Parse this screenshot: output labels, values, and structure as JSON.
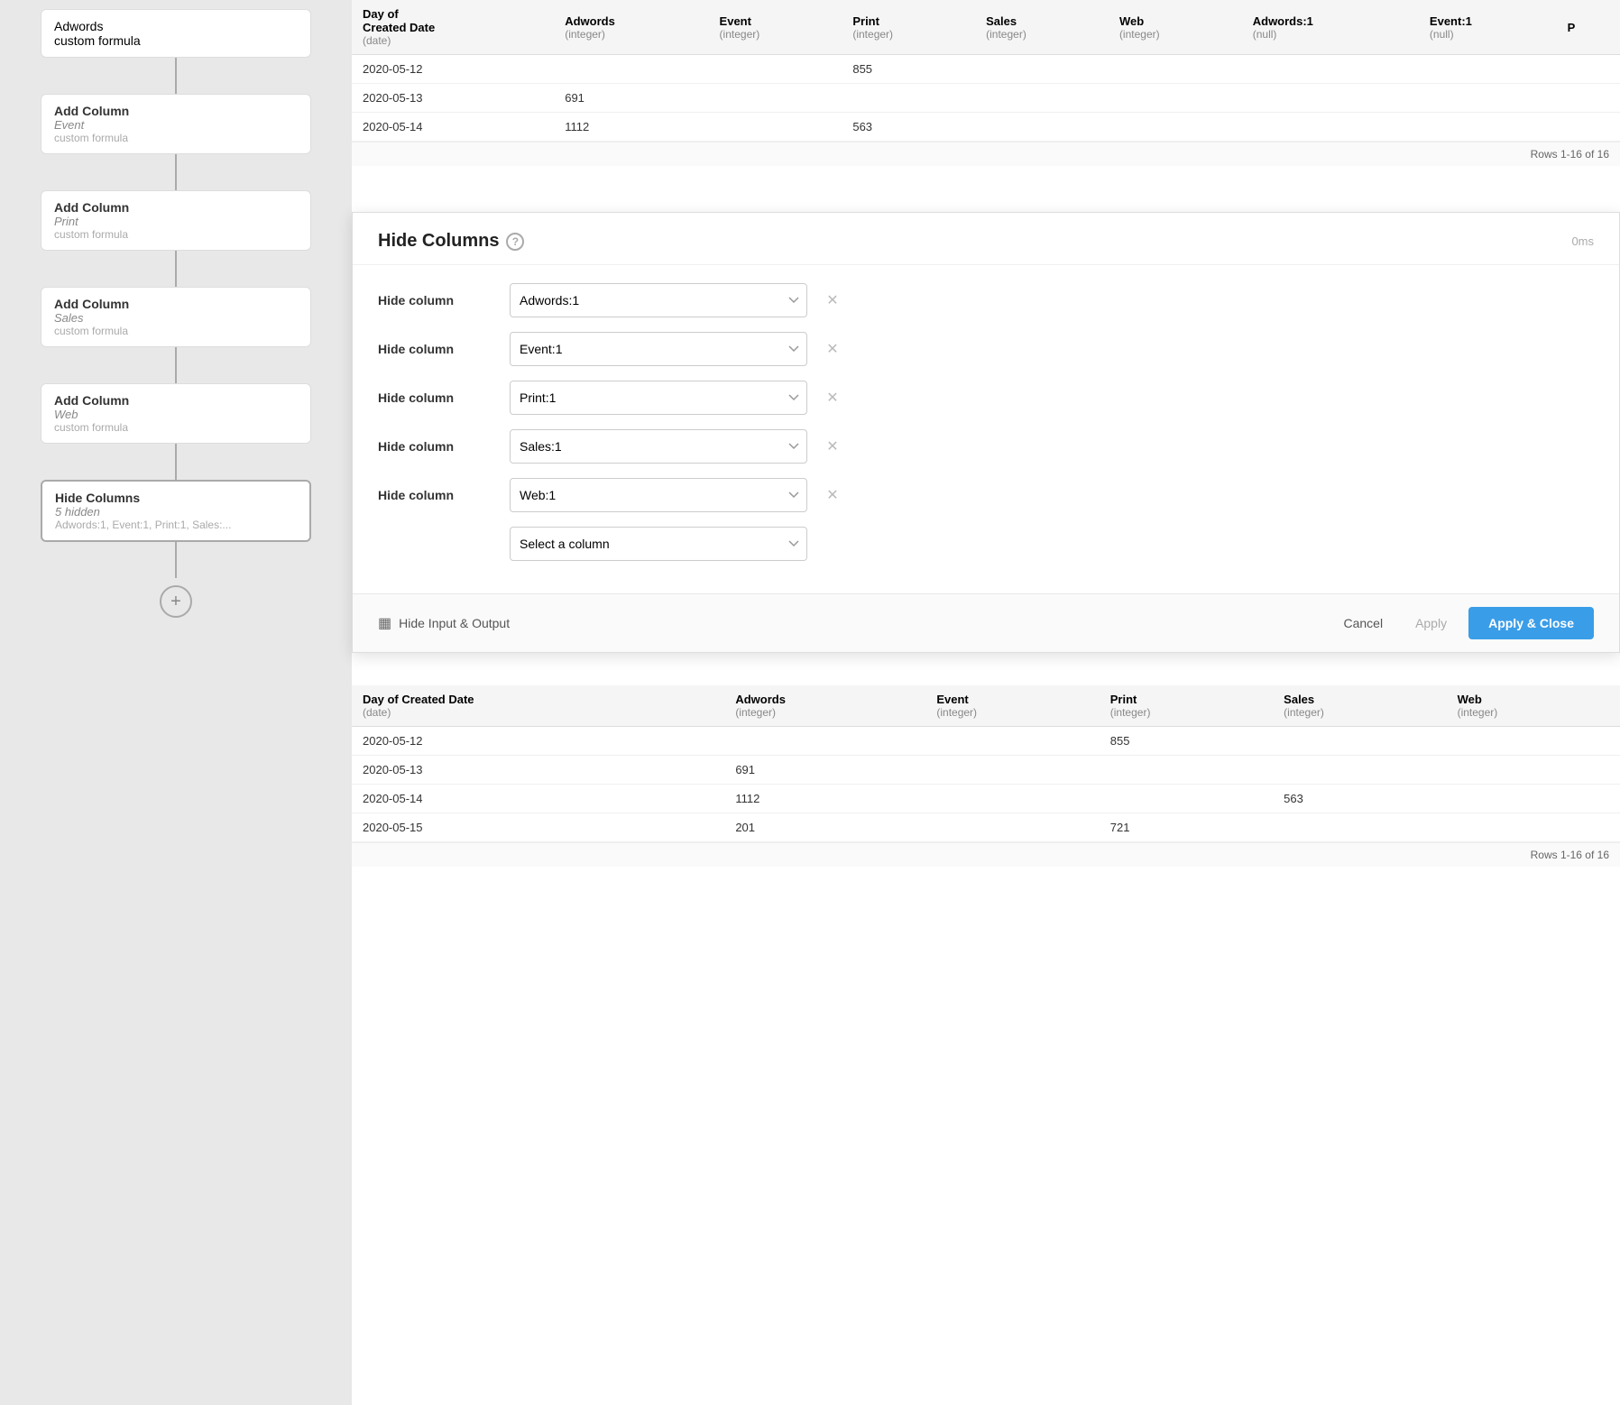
{
  "pipeline": {
    "nodes": [
      {
        "id": "node-adwords-partial",
        "title": "Adwords",
        "subtitle": null,
        "type": "custom formula",
        "partial": true
      },
      {
        "id": "node-event",
        "title": "Add Column",
        "subtitle": "Event",
        "type": "custom formula"
      },
      {
        "id": "node-print",
        "title": "Add Column",
        "subtitle": "Print",
        "type": "custom formula"
      },
      {
        "id": "node-sales",
        "title": "Add Column",
        "subtitle": "Sales",
        "type": "custom formula"
      },
      {
        "id": "node-web",
        "title": "Add Column",
        "subtitle": "Web",
        "type": "custom formula"
      },
      {
        "id": "node-hide-columns",
        "title": "Hide Columns",
        "subtitle": "5 hidden",
        "type": "Adwords:1, Event:1, Print:1, Sales:..."
      }
    ],
    "add_button_label": "+"
  },
  "top_table": {
    "columns": [
      {
        "name": "Day of Created Date",
        "type": "date"
      },
      {
        "name": "Adwords",
        "type": "integer"
      },
      {
        "name": "Event",
        "type": "integer"
      },
      {
        "name": "Print",
        "type": "integer"
      },
      {
        "name": "Sales",
        "type": "integer"
      },
      {
        "name": "Web",
        "type": "integer"
      },
      {
        "name": "Adwords:1",
        "type": "null"
      },
      {
        "name": "Event:1",
        "type": "null"
      },
      {
        "name": "P",
        "type": ""
      }
    ],
    "rows": [
      [
        "2020-05-12",
        "",
        "",
        "855",
        "",
        "",
        "",
        "",
        ""
      ],
      [
        "2020-05-13",
        "691",
        "",
        "",
        "",
        "",
        "",
        "",
        ""
      ],
      [
        "2020-05-14",
        "1112",
        "",
        "563",
        "",
        "",
        "",
        "",
        ""
      ]
    ],
    "rows_label": "Rows 1-16 of 16"
  },
  "dialog": {
    "title": "Hide Columns",
    "ms_label": "0ms",
    "hide_rows": [
      {
        "label": "Hide column",
        "value": "Adwords:1"
      },
      {
        "label": "Hide column",
        "value": "Event:1"
      },
      {
        "label": "Hide column",
        "value": "Print:1"
      },
      {
        "label": "Hide column",
        "value": "Sales:1"
      },
      {
        "label": "Hide column",
        "value": "Web:1"
      }
    ],
    "select_placeholder": "Select a column",
    "footer": {
      "left_icon": "table",
      "left_label": "Hide Input & Output",
      "cancel_label": "Cancel",
      "apply_label": "Apply",
      "apply_close_label": "Apply & Close"
    }
  },
  "bottom_table": {
    "columns": [
      {
        "name": "Day of Created Date",
        "type": "date"
      },
      {
        "name": "Adwords",
        "type": "integer"
      },
      {
        "name": "Event",
        "type": "integer"
      },
      {
        "name": "Print",
        "type": "integer"
      },
      {
        "name": "Sales",
        "type": "integer"
      },
      {
        "name": "Web",
        "type": "integer"
      }
    ],
    "rows": [
      [
        "2020-05-12",
        "",
        "",
        "855",
        "",
        ""
      ],
      [
        "2020-05-13",
        "691",
        "",
        "",
        "",
        ""
      ],
      [
        "2020-05-14",
        "1112",
        "",
        "",
        "563",
        ""
      ],
      [
        "2020-05-15",
        "201",
        "",
        "721",
        "",
        ""
      ]
    ],
    "rows_label": "Rows 1-16 of 16"
  }
}
